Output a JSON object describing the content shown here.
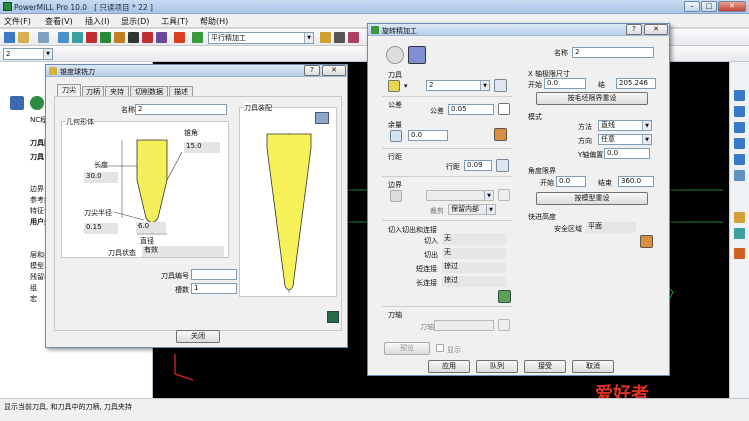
{
  "app": {
    "title": "PowerMILL Pro 10.0",
    "project": "[ 只读项目 * 22 ]"
  },
  "menu": [
    "文件(F)",
    "查看(V)",
    "插入(I)",
    "显示(D)",
    "工具(T)",
    "帮助(H)"
  ],
  "toolbar": {
    "toolpath_combo": "平行精加工",
    "level_combo": "2"
  },
  "tree": [
    "NC程",
    "刀具路",
    "刀具",
    "边界",
    "参考线",
    "特征设",
    "用户坐",
    "层和组",
    "模型",
    "残留模",
    "组",
    "宏"
  ],
  "status": "显示当前刀具, 和刀具中的刀柄, 刀具夹持",
  "tool_dialog": {
    "title": "锥度球铣刀",
    "help": "?",
    "tabs": [
      "刀尖",
      "刀柄",
      "夹持",
      "切削数据",
      "描述"
    ],
    "name_label": "名称",
    "name_value": "2",
    "geometry_title": "几何形体",
    "taper_angle_label": "锥角",
    "taper_angle_value": "15.0",
    "length_label": "长度",
    "length_value": "30.0",
    "tip_radius_label": "刀尖半径",
    "tip_radius_value": "0.15",
    "diameter_value": "6.0",
    "diameter_label": "直径",
    "tool_state_label": "刀具状态",
    "tool_state_value": "有效",
    "assembly_title": "刀具装配",
    "tool_number_label": "刀具编号",
    "tool_number_value": "",
    "flutes_label": "槽数",
    "flutes_value": "1",
    "close_label": "关闭"
  },
  "finish_dialog": {
    "title": "旋转精加工",
    "help": "?",
    "name_label": "名称",
    "name_value": "2",
    "tool_section": "刀具",
    "tool_value": "2",
    "x_limit_title": "X 轴极限尺寸",
    "start_label": "开始",
    "start_value": "0.0",
    "end_label": "结",
    "end_value": "205.246",
    "x_limit_button": "按毛坯限界重设",
    "tolerance_section": "公差",
    "tolerance_label": "公差",
    "tolerance_value": "0.05",
    "allowance_section": "余量",
    "allowance_value": "0.0",
    "mode_section": "模式",
    "method_label": "方法",
    "method_value": "直线",
    "direction_label": "方向",
    "direction_value": "任意",
    "y_offset_label": "Y轴偏置",
    "y_offset_value": "0.0",
    "stepover_section": "行距",
    "stepover_label": "行距",
    "stepover_value": "0.09",
    "angle_title": "角度限界",
    "angle_start_label": "开始",
    "angle_start_value": "0.0",
    "angle_end_label": "结束",
    "angle_end_value": "360.0",
    "angle_button": "按模型重设",
    "boundary_section": "边界",
    "boundary_label": "裁剪",
    "boundary_value": "保留内部",
    "rapid_title": "快进高度",
    "safe_area_label": "安全区域",
    "safe_area_value": "平面",
    "leads_section": "切入切出和连接",
    "lead_in_label": "切入",
    "lead_in_value": "无",
    "lead_out_label": "切出",
    "lead_out_value": "无",
    "short_link_label": "短连接",
    "short_link_value": "掠过",
    "long_link_label": "长连接",
    "long_link_value": "掠过",
    "axis_section": "刀轴",
    "axis_label": "刀轴",
    "preview_label": "预览",
    "show_label": "显示",
    "apply_label": "应用",
    "queue_label": "队列",
    "accept_label": "接受",
    "cancel_label": "取消"
  },
  "watermark": "爱好者"
}
